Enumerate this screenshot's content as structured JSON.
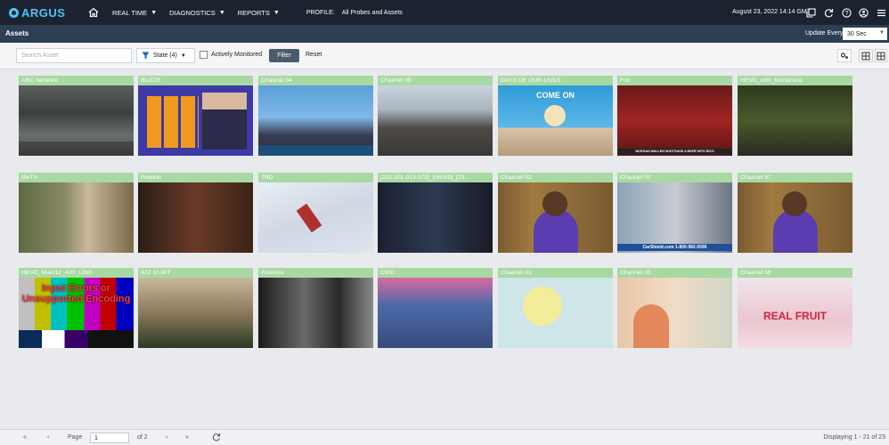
{
  "app": {
    "name": "ARGUS",
    "nav": {
      "realtime": "REAL TIME",
      "diagnostics": "DIAGNOSTICS",
      "reports": "REPORTS",
      "profile_label": "PROFILE:",
      "profile_value": "All Probes and Assets"
    },
    "datetime": "August 23, 2022 14:14 GMT",
    "icons": [
      "home-icon",
      "copy-icon",
      "refresh-icon",
      "help-icon",
      "user-icon",
      "menu-icon"
    ]
  },
  "subheader": {
    "title": "Assets",
    "update_label": "Update Every:",
    "update_value": "30 Sec"
  },
  "filters": {
    "search_placeholder": "Search Asset",
    "state_label": "State (4)",
    "actively_monitored": "Actively Monitored",
    "filter_btn": "Filter",
    "reset_btn": "Reset"
  },
  "assets": [
    {
      "name": "ABC Network"
    },
    {
      "name": "BUZZR"
    },
    {
      "name": "Channel 04"
    },
    {
      "name": "Channel 08"
    },
    {
      "name": "DAYS OF OUR LIVES",
      "overlay": "COME ON"
    },
    {
      "name": "Fox",
      "overlay": "MORGAN WALLEN SHOTGUNS A BEER WITH RIZZI"
    },
    {
      "name": "HEVC_with_blockiness"
    },
    {
      "name": "MeTV"
    },
    {
      "name": "Rewind"
    },
    {
      "name": "TBD"
    },
    {
      "name": "[222.001.013.073]_[06000]_[23..."
    },
    {
      "name": "Channel 02"
    },
    {
      "name": "Channel 07",
      "overlay": "CarShield.com  1-800-982-5596"
    },
    {
      "name": "Channel 87"
    },
    {
      "name": "HEVC_Main12_420_12bit",
      "overlay": "Input Errors or Unsupported Encoding"
    },
    {
      "name": "422 10-BIT"
    },
    {
      "name": "Antenna"
    },
    {
      "name": "CWD"
    },
    {
      "name": "Channel 01"
    },
    {
      "name": "Channel 03"
    },
    {
      "name": "Channel 58",
      "overlay": "REAL FRUIT"
    }
  ],
  "footer": {
    "page_label": "Page",
    "page_value": "1",
    "of_label": "of 2",
    "displaying": "Displaying 1 - 21 of 23"
  },
  "colors": {
    "topbar": "#1b2330",
    "subbar": "#2c3f54",
    "tile_header": "#a8d9a2",
    "accent": "#4fc3f7"
  }
}
